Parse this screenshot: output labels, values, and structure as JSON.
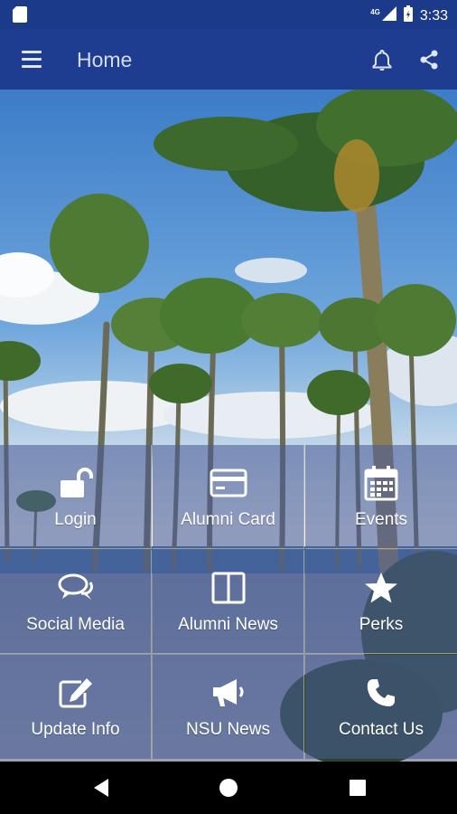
{
  "status_bar": {
    "network": "4G",
    "time": "3:33"
  },
  "app_bar": {
    "title": "Home"
  },
  "tiles": [
    {
      "label": "Login",
      "icon": "unlock-icon"
    },
    {
      "label": "Alumni Card",
      "icon": "card-icon"
    },
    {
      "label": "Events",
      "icon": "calendar-icon"
    },
    {
      "label": "Social Media",
      "icon": "chat-icon"
    },
    {
      "label": "Alumni News",
      "icon": "newspaper-icon"
    },
    {
      "label": "Perks",
      "icon": "star-icon"
    },
    {
      "label": "Update Info",
      "icon": "edit-icon"
    },
    {
      "label": "NSU News",
      "icon": "megaphone-icon"
    },
    {
      "label": "Contact Us",
      "icon": "phone-icon"
    }
  ],
  "colors": {
    "app_bar": "#1f3d90",
    "status_bar": "#1b3a8a",
    "tile_overlay": "#485c96"
  }
}
